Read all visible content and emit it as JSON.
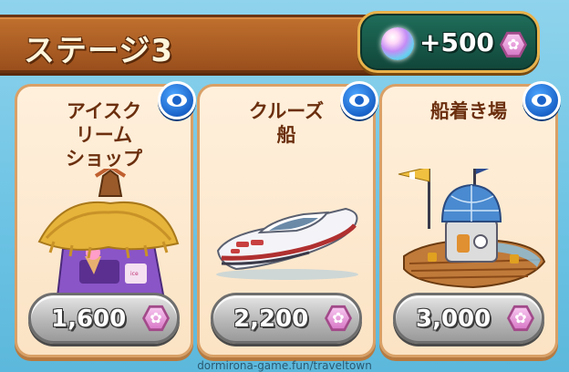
{
  "header": {
    "title": "ステージ3"
  },
  "reward": {
    "amount": "+500",
    "orb_icon": "rainbow-orb-icon",
    "currency_icon": "flower-gem-icon"
  },
  "cards": [
    {
      "title": "アイスク\nリーム\nショップ",
      "price": "1,600",
      "illustration": "ice-cream-shop-icon"
    },
    {
      "title": "クルーズ\n船",
      "price": "2,200",
      "illustration": "cruise-boat-icon"
    },
    {
      "title": "船着き場",
      "price": "3,000",
      "illustration": "dock-observatory-icon"
    }
  ],
  "footer": {
    "watermark": "dormirona-game.fun/traveltown"
  },
  "colors": {
    "banner": "#9a4f1c",
    "card_bg": "#fbe3c4",
    "card_border": "#d9a066",
    "eye_button": "#1a63c9",
    "gem": "#d878c7",
    "reward_bg": "#11463a"
  }
}
